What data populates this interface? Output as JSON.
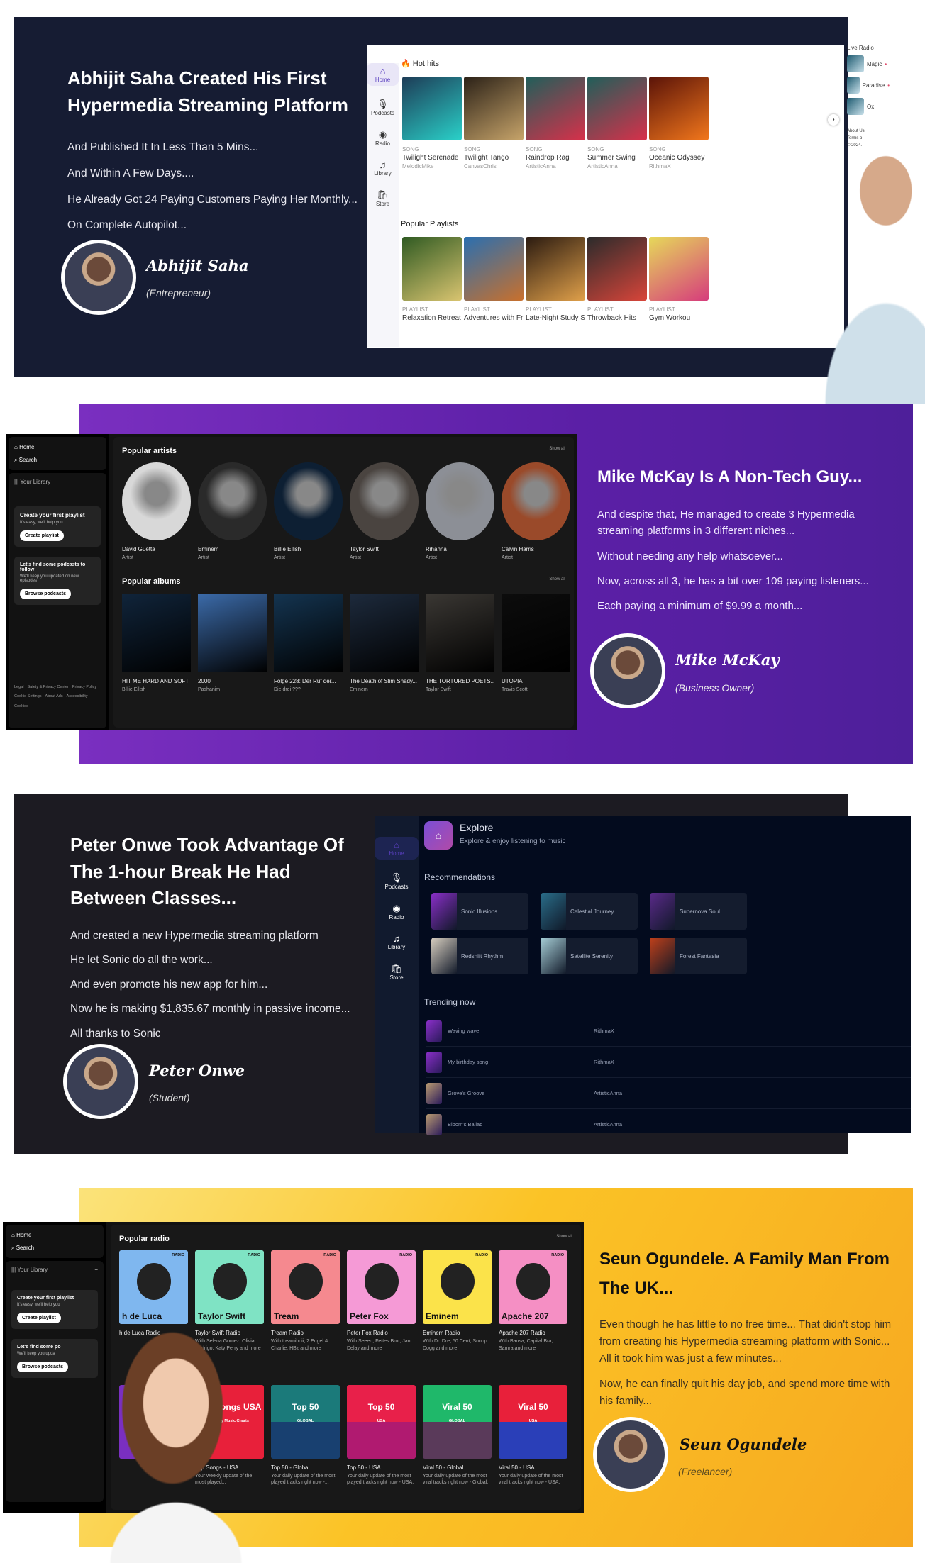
{
  "colors": {
    "section1_bg": "#161c33",
    "section2_bg": "#5b1fa6",
    "section3_bg": "#1c1b22",
    "section4_bg": "#fbc326",
    "spotify_bg": "#121212",
    "explore_bg": "#030b1e",
    "accent_purple": "#7b4fd6"
  },
  "s1": {
    "title": "Abhijit Saha Created His First Hypermedia Streaming Platform",
    "paragraphs": [
      "And Published It In Less Than 5 Mins...",
      "And Within A Few Days....",
      "He Already Got 24 Paying Customers Paying Her Monthly...",
      "On Complete Autopilot..."
    ],
    "name": "Abhijit Saha",
    "role": "(Entrepreneur)",
    "app": {
      "nav": [
        {
          "icon": "home-icon",
          "glyph": "⌂",
          "label": "Home"
        },
        {
          "icon": "microphone-icon",
          "glyph": "🎙",
          "label": "Podcasts"
        },
        {
          "icon": "radio-icon",
          "glyph": "◉",
          "label": "Radio"
        },
        {
          "icon": "library-icon",
          "glyph": "♫",
          "label": "Library"
        },
        {
          "icon": "store-bag-icon",
          "glyph": "🛍",
          "label": "Store"
        }
      ],
      "hot_hits_title": "Hot hits",
      "hot_hits": [
        {
          "type": "SONG",
          "title": "Twilight Serenade",
          "artist": "MelodicMike",
          "c1": "#1d3b56",
          "c2": "#2ad1c9"
        },
        {
          "type": "SONG",
          "title": "Twilight Tango",
          "artist": "CanvasChris",
          "c1": "#2b2117",
          "c2": "#c7a46a"
        },
        {
          "type": "SONG",
          "title": "Raindrop Rag",
          "artist": "ArtisticAnna",
          "c1": "#1f5f5a",
          "c2": "#d8304a"
        },
        {
          "type": "SONG",
          "title": "Summer Swing",
          "artist": "ArtisticAnna",
          "c1": "#1f5f5a",
          "c2": "#d8304a"
        },
        {
          "type": "SONG",
          "title": "Oceanic Odyssey",
          "artist": "RithmaX",
          "c1": "#5a1308",
          "c2": "#f2771c"
        }
      ],
      "playlists_title": "Popular Playlists",
      "playlists": [
        {
          "type": "PLAYLIST",
          "title": "Relaxation Retreat",
          "c1": "#2f5a22",
          "c2": "#d9c470"
        },
        {
          "type": "PLAYLIST",
          "title": "Adventures with Friends",
          "c1": "#2a6fb0",
          "c2": "#c9702c"
        },
        {
          "type": "PLAYLIST",
          "title": "Late-Night Study Session",
          "c1": "#2a1a10",
          "c2": "#e0a04a"
        },
        {
          "type": "PLAYLIST",
          "title": "Throwback Hits",
          "c1": "#2b2b2b",
          "c2": "#d8453a"
        },
        {
          "type": "PLAYLIST",
          "title": "Gym Workou",
          "c1": "#e6d95a",
          "c2": "#d63c7c"
        }
      ],
      "live_radio_title": "Live Radio",
      "live_radio": [
        "Magic",
        "Paradise",
        "Ox"
      ],
      "footer": [
        "About Us",
        "Terms o",
        "© 2024."
      ]
    }
  },
  "s2": {
    "title": "Mike McKay Is A Non-Tech Guy...",
    "paragraphs": [
      "And despite that, He managed to create 3 Hypermedia streaming platforms in 3 different niches...",
      "Without needing any help whatsoever...",
      "Now, across all 3, he has a bit over 109 paying listeners...",
      "Each paying a minimum of $9.99 a month..."
    ],
    "name": "Mike McKay",
    "role": "(Business Owner)",
    "app": {
      "home": "Home",
      "search": "Search",
      "library": "Your Library",
      "plus": "+",
      "create_title": "Create your first playlist",
      "create_sub": "It's easy, we'll help you",
      "create_btn": "Create playlist",
      "pod_title": "Let's find some podcasts to follow",
      "pod_sub": "We'll keep you updated on new episodes",
      "pod_btn": "Browse podcasts",
      "footer_links": [
        "Legal",
        "Safety & Privacy Center",
        "Privacy Policy",
        "Cookie Settings",
        "About Ads",
        "Accessibility",
        "Cookies"
      ],
      "artists_title": "Popular artists",
      "show_all": "Show all",
      "artists": [
        {
          "name": "David Guetta",
          "sub": "Artist",
          "c": "#d8d8d8"
        },
        {
          "name": "Eminem",
          "sub": "Artist",
          "c": "#2a2a2a"
        },
        {
          "name": "Billie Eilish",
          "sub": "Artist",
          "c": "#0d1f33"
        },
        {
          "name": "Taylor Swift",
          "sub": "Artist",
          "c": "#4a4440"
        },
        {
          "name": "Rihanna",
          "sub": "Artist",
          "c": "#8c8f96"
        },
        {
          "name": "Calvin Harris",
          "sub": "Artist",
          "c": "#9a4a2a"
        }
      ],
      "albums_title": "Popular albums",
      "albums": [
        {
          "name": "HIT ME HARD AND SOFT",
          "sub": "Billie Eilish",
          "c": "#10243a"
        },
        {
          "name": "2000",
          "sub": "Pashanim",
          "c": "#3b6aa8"
        },
        {
          "name": "Folge 228: Der Ruf der...",
          "sub": "Die drei ???",
          "c": "#143450"
        },
        {
          "name": "The Death of Slim Shady...",
          "sub": "Eminem",
          "c": "#1d2a3c"
        },
        {
          "name": "THE TORTURED POETS...",
          "sub": "Taylor Swift",
          "c": "#3a3733"
        },
        {
          "name": "UTOPIA",
          "sub": "Travis Scott",
          "c": "#0c0c0c"
        }
      ]
    }
  },
  "s3": {
    "title": "Peter Onwe Took Advantage Of The 1-hour Break He Had Between Classes...",
    "paragraphs": [
      "And created a new Hypermedia streaming platform",
      "He let Sonic do all the work...",
      "And even promote his new app for him...",
      "Now he is making $1,835.67 monthly in passive income...",
      "All thanks to Sonic"
    ],
    "name": "Peter Onwe",
    "role": "(Student)",
    "app": {
      "nav": [
        {
          "icon": "home-icon",
          "glyph": "⌂",
          "label": "Home"
        },
        {
          "icon": "microphone-icon",
          "glyph": "🎙",
          "label": "Podcasts"
        },
        {
          "icon": "radio-icon",
          "glyph": "◉",
          "label": "Radio"
        },
        {
          "icon": "library-icon",
          "glyph": "♫",
          "label": "Library"
        },
        {
          "icon": "store-bag-icon",
          "glyph": "🛍",
          "label": "Store"
        }
      ],
      "header_title": "Explore",
      "header_sub": "Explore & enjoy listening to music",
      "rec_title": "Recommendations",
      "recs": [
        {
          "name": "Sonic Illusions",
          "c": "#8a2fc9"
        },
        {
          "name": "Celestial Journey",
          "c": "#2a6e8a"
        },
        {
          "name": "Supernova Soul",
          "c": "#5a2a8a"
        },
        {
          "name": "Redshift Rhythm",
          "c": "#d8cfc0"
        },
        {
          "name": "Satellite Serenity",
          "c": "#a8d0d8"
        },
        {
          "name": "Forest Fantasia",
          "c": "#c0401a"
        }
      ],
      "trend_title": "Trending now",
      "trending": [
        {
          "name": "Waving wave",
          "artist": "RithmaX",
          "c": "#8a2fc9"
        },
        {
          "name": "My birthday song",
          "artist": "RithmaX",
          "c": "#8a2fc9"
        },
        {
          "name": "Grove's Groove",
          "artist": "ArtisticAnna",
          "c": "#b89a70"
        },
        {
          "name": "Bloom's Ballad",
          "artist": "ArtisticAnna",
          "c": "#b89a70"
        }
      ]
    }
  },
  "s4": {
    "title": "Seun Ogundele. A Family Man From The UK...",
    "paragraphs": [
      "Even though he has little to no free time... That didn't stop him from creating his Hypermedia streaming platform with Sonic... All it took him was just a few minutes...",
      "Now, he can finally quit his day job, and spend more time with his family..."
    ],
    "name": "Seun Ogundele",
    "role": "(Freelancer)",
    "app": {
      "home": "Home",
      "search": "Search",
      "library": "Your Library",
      "plus": "+",
      "create_title": "Create your first playlist",
      "create_sub": "It's easy, we'll help you",
      "create_btn": "Create playlist",
      "pod_title": "Let's find some po",
      "pod_sub": "We'll keep you upda",
      "pod_btn": "Browse podcasts",
      "radio_title": "Popular radio",
      "show_all": "Show all",
      "radio_tag": "RADIO",
      "radio": [
        {
          "big": "h de Luca",
          "name": "h de Luca Radio",
          "sub": "",
          "c": "#7fb7ef"
        },
        {
          "big": "Taylor Swift",
          "name": "Taylor Swift Radio",
          "sub": "With Selena Gomez, Olivia Rodrigo, Katy Perry and more",
          "c": "#7fe3c4"
        },
        {
          "big": "Tream",
          "name": "Tream Radio",
          "sub": "With treamiboii, 2 Engel & Charlie, HBz and more",
          "c": "#f5898f"
        },
        {
          "big": "Peter Fox",
          "name": "Peter Fox Radio",
          "sub": "With Seeed, Fettes Brot, Jan Delay and more",
          "c": "#f59ad6"
        },
        {
          "big": "Eminem",
          "name": "Eminem Radio",
          "sub": "With Dr. Dre, 50 Cent, Snoop Dogg and more",
          "c": "#fbe34a"
        },
        {
          "big": "Apache 207",
          "name": "Apache 207 Radio",
          "sub": "With Bausa, Capital Bra, Samra and more",
          "c": "#f58fc4"
        }
      ],
      "charts_title_partial": "ts",
      "charts": [
        {
          "big": "",
          "small": "",
          "name": "",
          "sub": "",
          "c": "#7a2fc0",
          "c2": "#7a2fc0"
        },
        {
          "big": "Top Songs USA",
          "small": "Weekly Music Charts",
          "name": "Top Songs - USA",
          "sub": "Your weekly update of the most played...",
          "c": "#e8203a",
          "c2": "#e8203a"
        },
        {
          "big": "Top 50",
          "small": "GLOBAL",
          "name": "Top 50 - Global",
          "sub": "Your daily update of the most played tracks right now -...",
          "c": "#1b7a7a",
          "c2": "#184070"
        },
        {
          "big": "Top 50",
          "small": "USA",
          "name": "Top 50 - USA",
          "sub": "Your daily update of the most played tracks right now - USA.",
          "c": "#e8204a",
          "c2": "#b01a70"
        },
        {
          "big": "Viral 50",
          "small": "GLOBAL",
          "name": "Viral 50 - Global",
          "sub": "Your daily update of the most viral tracks right now - Global.",
          "c": "#1fb86a",
          "c2": "#5a3a5a"
        },
        {
          "big": "Viral 50",
          "small": "USA",
          "name": "Viral 50 - USA",
          "sub": "Your daily update of the most viral tracks right now - USA.",
          "c": "#e8203a",
          "c2": "#2a3fb8"
        }
      ]
    }
  }
}
